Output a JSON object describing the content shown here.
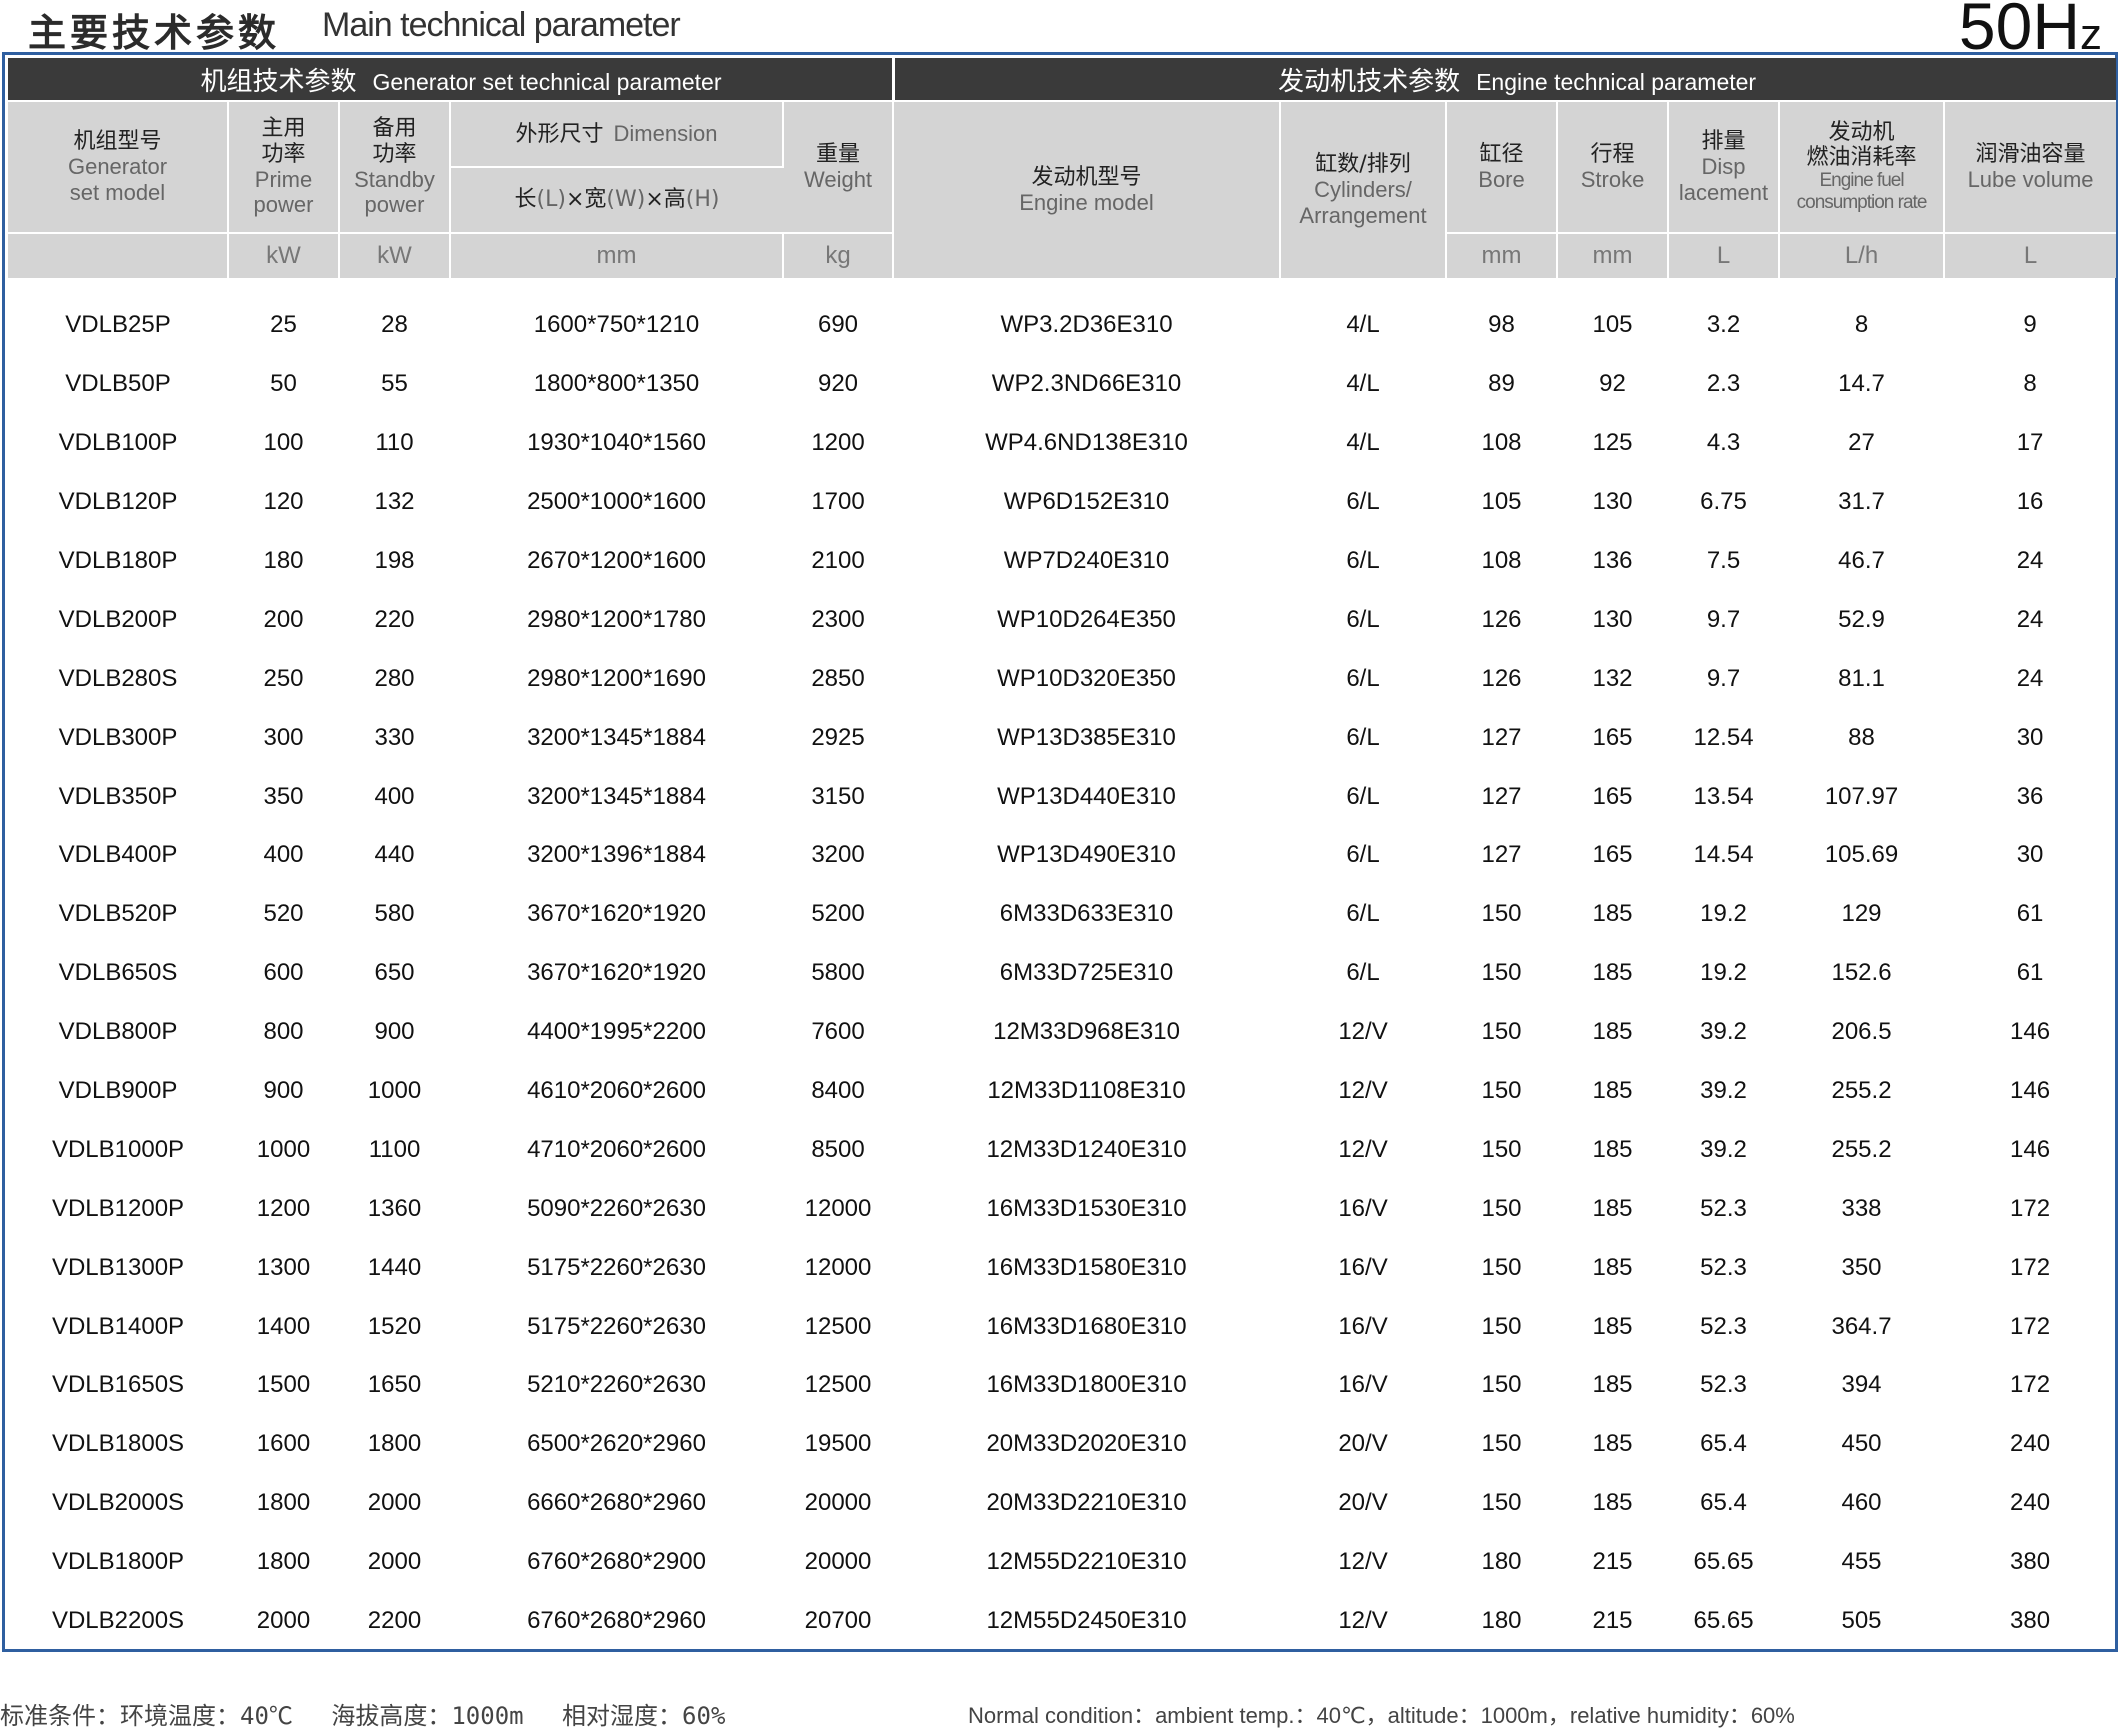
{
  "title": {
    "zh": "主要技术参数",
    "en": "Main technical parameter",
    "freq_main": "50H",
    "freq_sub": "z"
  },
  "groups": {
    "genset_zh": "机组技术参数",
    "genset_en": "Generator set technical parameter",
    "engine_zh": "发动机技术参数",
    "engine_en": "Engine technical parameter"
  },
  "headers": {
    "model_zh": "机组型号",
    "model_en1": "Generator",
    "model_en2": "set model",
    "prime_zh1": "主用",
    "prime_zh2": "功率",
    "prime_en1": "Prime",
    "prime_en2": "power",
    "standby_zh1": "备用",
    "standby_zh2": "功率",
    "standby_en1": "Standby",
    "standby_en2": "power",
    "dim_zh": "外形尺寸",
    "dim_en": "Dimension",
    "dim_l_zh": "长",
    "dim_l": "(L)",
    "dim_w_zh": "×宽",
    "dim_w": "(W)",
    "dim_h_zh": "×高",
    "dim_h": "(H)",
    "weight_zh": "重量",
    "weight_en": "Weight",
    "engine_zh": "发动机型号",
    "engine_en": "Engine model",
    "cyl_zh": "缸数/排列",
    "cyl_en1": "Cylinders/",
    "cyl_en2": "Arrangement",
    "bore_zh": "缸径",
    "bore_en": "Bore",
    "stroke_zh": "行程",
    "stroke_en": "Stroke",
    "disp_zh": "排量",
    "disp_en1": "Disp",
    "disp_en2": "lacement",
    "fuel_zh1": "发动机",
    "fuel_zh2": "燃油消耗率",
    "fuel_en1": "Engine fuel",
    "fuel_en2": "consumption rate",
    "lube_zh": "润滑油容量",
    "lube_en": "Lube volume"
  },
  "units": {
    "prime": "kW",
    "standby": "kW",
    "dim": "mm",
    "weight": "kg",
    "bore": "mm",
    "stroke": "mm",
    "disp": "L",
    "fuel": "L/h",
    "lube": "L"
  },
  "rows": [
    [
      "VDLB25P",
      "25",
      "28",
      "1600*750*1210",
      "690",
      "WP3.2D36E310",
      "4/L",
      "98",
      "105",
      "3.2",
      "8",
      "9"
    ],
    [
      "VDLB50P",
      "50",
      "55",
      "1800*800*1350",
      "920",
      "WP2.3ND66E310",
      "4/L",
      "89",
      "92",
      "2.3",
      "14.7",
      "8"
    ],
    [
      "VDLB100P",
      "100",
      "110",
      "1930*1040*1560",
      "1200",
      "WP4.6ND138E310",
      "4/L",
      "108",
      "125",
      "4.3",
      "27",
      "17"
    ],
    [
      "VDLB120P",
      "120",
      "132",
      "2500*1000*1600",
      "1700",
      "WP6D152E310",
      "6/L",
      "105",
      "130",
      "6.75",
      "31.7",
      "16"
    ],
    [
      "VDLB180P",
      "180",
      "198",
      "2670*1200*1600",
      "2100",
      "WP7D240E310",
      "6/L",
      "108",
      "136",
      "7.5",
      "46.7",
      "24"
    ],
    [
      "VDLB200P",
      "200",
      "220",
      "2980*1200*1780",
      "2300",
      "WP10D264E350",
      "6/L",
      "126",
      "130",
      "9.7",
      "52.9",
      "24"
    ],
    [
      "VDLB280S",
      "250",
      "280",
      "2980*1200*1690",
      "2850",
      "WP10D320E350",
      "6/L",
      "126",
      "132",
      "9.7",
      "81.1",
      "24"
    ],
    [
      "VDLB300P",
      "300",
      "330",
      "3200*1345*1884",
      "2925",
      "WP13D385E310",
      "6/L",
      "127",
      "165",
      "12.54",
      "88",
      "30"
    ],
    [
      "VDLB350P",
      "350",
      "400",
      "3200*1345*1884",
      "3150",
      "WP13D440E310",
      "6/L",
      "127",
      "165",
      "13.54",
      "107.97",
      "36"
    ],
    [
      "VDLB400P",
      "400",
      "440",
      "3200*1396*1884",
      "3200",
      "WP13D490E310",
      "6/L",
      "127",
      "165",
      "14.54",
      "105.69",
      "30"
    ],
    [
      "VDLB520P",
      "520",
      "580",
      "3670*1620*1920",
      "5200",
      "6M33D633E310",
      "6/L",
      "150",
      "185",
      "19.2",
      "129",
      "61"
    ],
    [
      "VDLB650S",
      "600",
      "650",
      "3670*1620*1920",
      "5800",
      "6M33D725E310",
      "6/L",
      "150",
      "185",
      "19.2",
      "152.6",
      "61"
    ],
    [
      "VDLB800P",
      "800",
      "900",
      "4400*1995*2200",
      "7600",
      "12M33D968E310",
      "12/V",
      "150",
      "185",
      "39.2",
      "206.5",
      "146"
    ],
    [
      "VDLB900P",
      "900",
      "1000",
      "4610*2060*2600",
      "8400",
      "12M33D1108E310",
      "12/V",
      "150",
      "185",
      "39.2",
      "255.2",
      "146"
    ],
    [
      "VDLB1000P",
      "1000",
      "1100",
      "4710*2060*2600",
      "8500",
      "12M33D1240E310",
      "12/V",
      "150",
      "185",
      "39.2",
      "255.2",
      "146"
    ],
    [
      "VDLB1200P",
      "1200",
      "1360",
      "5090*2260*2630",
      "12000",
      "16M33D1530E310",
      "16/V",
      "150",
      "185",
      "52.3",
      "338",
      "172"
    ],
    [
      "VDLB1300P",
      "1300",
      "1440",
      "5175*2260*2630",
      "12000",
      "16M33D1580E310",
      "16/V",
      "150",
      "185",
      "52.3",
      "350",
      "172"
    ],
    [
      "VDLB1400P",
      "1400",
      "1520",
      "5175*2260*2630",
      "12500",
      "16M33D1680E310",
      "16/V",
      "150",
      "185",
      "52.3",
      "364.7",
      "172"
    ],
    [
      "VDLB1650S",
      "1500",
      "1650",
      "5210*2260*2630",
      "12500",
      "16M33D1800E310",
      "16/V",
      "150",
      "185",
      "52.3",
      "394",
      "172"
    ],
    [
      "VDLB1800S",
      "1600",
      "1800",
      "6500*2620*2960",
      "19500",
      "20M33D2020E310",
      "20/V",
      "150",
      "185",
      "65.4",
      "450",
      "240"
    ],
    [
      "VDLB2000S",
      "1800",
      "2000",
      "6660*2680*2960",
      "20000",
      "20M33D2210E310",
      "20/V",
      "150",
      "185",
      "65.4",
      "460",
      "240"
    ],
    [
      "VDLB1800P",
      "1800",
      "2000",
      "6760*2680*2900",
      "20000",
      "12M55D2210E310",
      "12/V",
      "180",
      "215",
      "65.65",
      "455",
      "380"
    ],
    [
      "VDLB2200S",
      "2000",
      "2200",
      "6760*2680*2960",
      "20700",
      "12M55D2450E310",
      "12/V",
      "180",
      "215",
      "65.65",
      "505",
      "380"
    ]
  ],
  "footer": {
    "zh": "标准条件：环境温度：40℃　 海拔高度：1000m　 相对湿度：60%",
    "en": "Normal condition：ambient temp.：40℃，altitude：1000m，relative humidity：60%"
  }
}
